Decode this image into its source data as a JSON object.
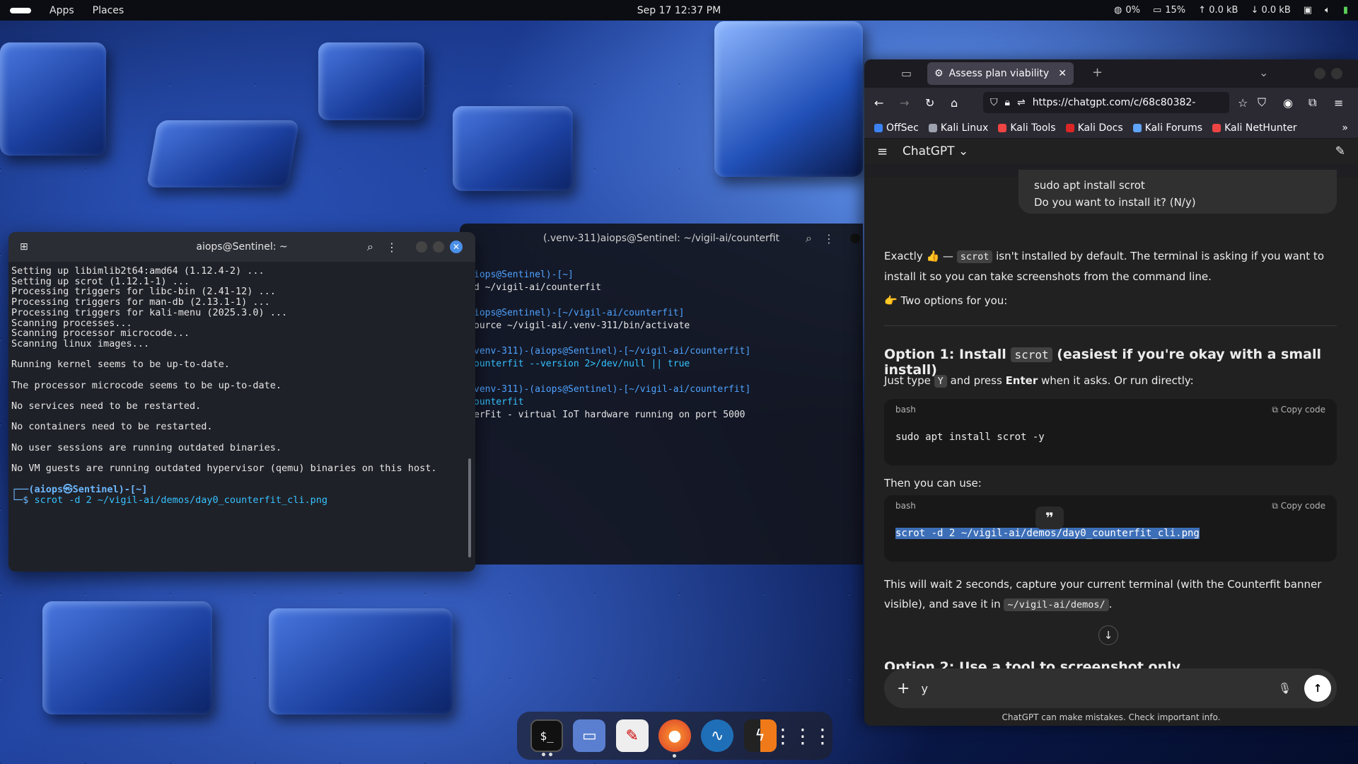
{
  "topbar": {
    "apps": "Apps",
    "places": "Places",
    "clock": "Sep 17  12:37 PM",
    "cpu": "0%",
    "mem": "15%",
    "up": "↑ 0.0 kB",
    "down": "↓ 0.0 kB"
  },
  "term_back": {
    "title": "(.venv-311)aiops@Sentinel: ~/vigil-ai/counterfit",
    "lines": [
      [
        "iops@Sentinel)-[~]"
      ],
      [
        "d ~/vigil-ai/counterfit"
      ],
      [
        ""
      ],
      [
        "iops@Sentinel)-[~/vigil-ai/counterfit]"
      ],
      [
        "ource ~/vigil-ai/.venv-311/bin/activate"
      ],
      [
        ""
      ],
      [
        "venv-311)-(aiops@Sentinel)-[~/vigil-ai/counterfit]"
      ],
      [
        "ounterfit --version 2>/dev/null || true"
      ],
      [
        ""
      ],
      [
        "venv-311)-(aiops@Sentinel)-[~/vigil-ai/counterfit]"
      ],
      [
        "ounterfit"
      ],
      [
        "erFit - virtual IoT hardware running on port 5000"
      ]
    ]
  },
  "term_front": {
    "title": "aiops@Sentinel: ~",
    "output": [
      "Setting up libimlib2t64:amd64 (1.12.4-2) ...",
      "Setting up scrot (1.12.1-1) ...",
      "Processing triggers for libc-bin (2.41-12) ...",
      "Processing triggers for man-db (2.13.1-1) ...",
      "Processing triggers for kali-menu (2025.3.0) ...",
      "Scanning processes...",
      "Scanning processor microcode...",
      "Scanning linux images...",
      "",
      "Running kernel seems to be up-to-date.",
      "",
      "The processor microcode seems to be up-to-date.",
      "",
      "No services need to be restarted.",
      "",
      "No containers need to be restarted.",
      "",
      "No user sessions are running outdated binaries.",
      "",
      "No VM guests are running outdated hypervisor (qemu) binaries on this host.",
      ""
    ],
    "prompt_user": "(aiops㉿Sentinel)-[~]",
    "prompt_cmd": "scrot -d 2 ~/vigil-ai/demos/day0_counterfit_cli.png"
  },
  "firefox": {
    "tab_title": "Assess plan viability",
    "url": "https://chatgpt.com/c/68c80382-",
    "bookmarks": [
      {
        "label": "OffSec",
        "color": "#3b82f6"
      },
      {
        "label": "Kali Linux",
        "color": "#9ca3af"
      },
      {
        "label": "Kali Tools",
        "color": "#ef4444"
      },
      {
        "label": "Kali Docs",
        "color": "#dc2626"
      },
      {
        "label": "Kali Forums",
        "color": "#60a5fa"
      },
      {
        "label": "Kali NetHunter",
        "color": "#ef4444"
      }
    ]
  },
  "chat": {
    "title": "ChatGPT",
    "bubble_line1": "sudo apt install scrot",
    "bubble_line2": "Do you want to install it? (N/y)",
    "p1_a": "Exactly 👍 — ",
    "p1_code": "scrot",
    "p1_b": " isn't installed by default. The terminal is asking if you want to install it so you can take screenshots from the command line.",
    "p2": "👉 Two options for you:",
    "h_option1_a": "Option 1: Install ",
    "h_option1_code": "scrot",
    "h_option1_b": " (easiest if you're okay with a small install)",
    "p3_a": "Just type ",
    "p3_code": "Y",
    "p3_b": " and press ",
    "p3_bold": "Enter",
    "p3_c": " when it asks. Or run directly:",
    "code1_lang": "bash",
    "copy_label": "Copy code",
    "code1": "sudo apt install scrot -y",
    "p4": "Then you can use:",
    "code2_lang": "bash",
    "code2": "scrot -d 2 ~/vigil-ai/demos/day0_counterfit_cli.png",
    "p5_a": "This will wait 2 seconds, capture your current terminal (with the Counterfit banner visible), and save it in ",
    "p5_code": "~/vigil-ai/demos/",
    "p5_b": ".",
    "partial_heading": "Option 2: Use a tool to screenshot only",
    "composer_value": "y",
    "disclaimer": "ChatGPT can make mistakes. Check important info."
  }
}
